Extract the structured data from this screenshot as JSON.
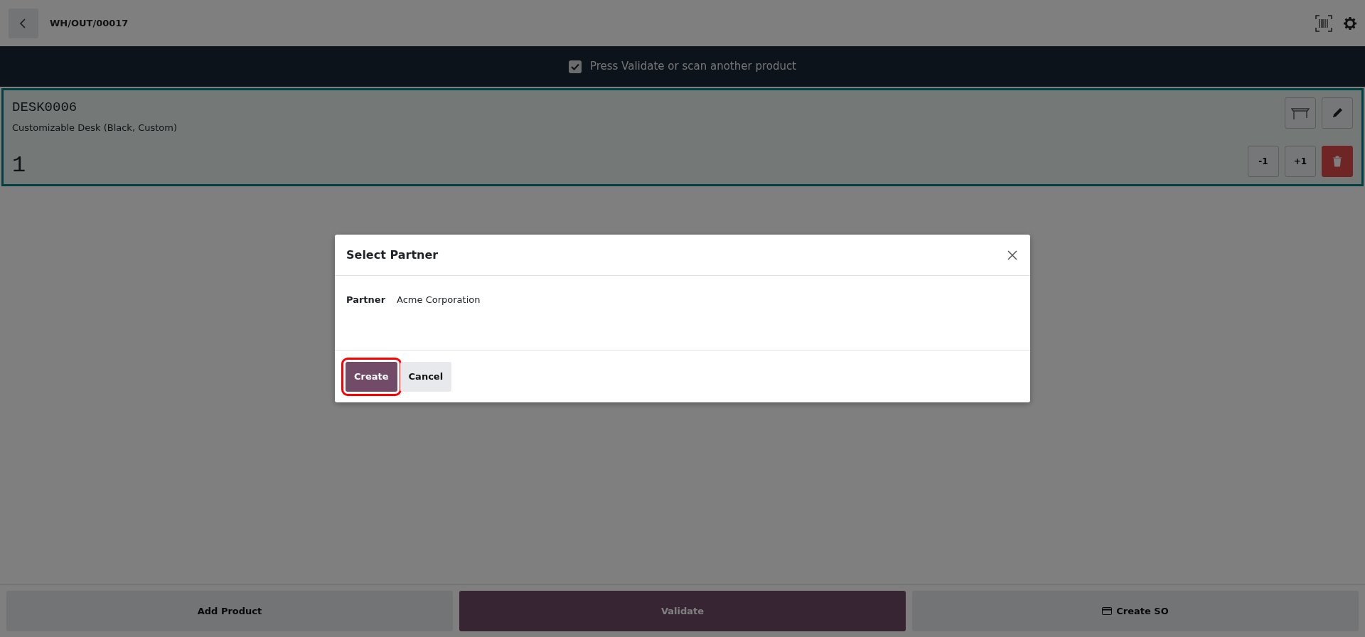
{
  "header": {
    "title": "WH/OUT/00017"
  },
  "banner": {
    "checked": true,
    "message": "Press Validate or scan another product"
  },
  "lines": [
    {
      "code": "DESK0006",
      "name": "Customizable Desk (Black, Custom)",
      "quantity": "1",
      "selected": true,
      "buttons": [
        {
          "label": "-1",
          "kind": "light"
        },
        {
          "label": "+1",
          "kind": "light"
        },
        {
          "kind": "delete"
        }
      ]
    }
  ],
  "dialog": {
    "title": "Select Partner",
    "fields": [
      {
        "label": "Partner",
        "value": "Acme Corporation"
      }
    ],
    "buttons": [
      {
        "label": "Create",
        "kind": "primary",
        "highlighted": true
      },
      {
        "label": "Cancel",
        "kind": "secondary",
        "highlighted": false
      }
    ]
  },
  "footer": {
    "buttons": [
      {
        "label": "Add Product",
        "kind": "light",
        "icon": false
      },
      {
        "label": "Validate",
        "kind": "primary",
        "icon": false
      },
      {
        "label": "Create SO",
        "kind": "light",
        "icon": true
      }
    ]
  }
}
